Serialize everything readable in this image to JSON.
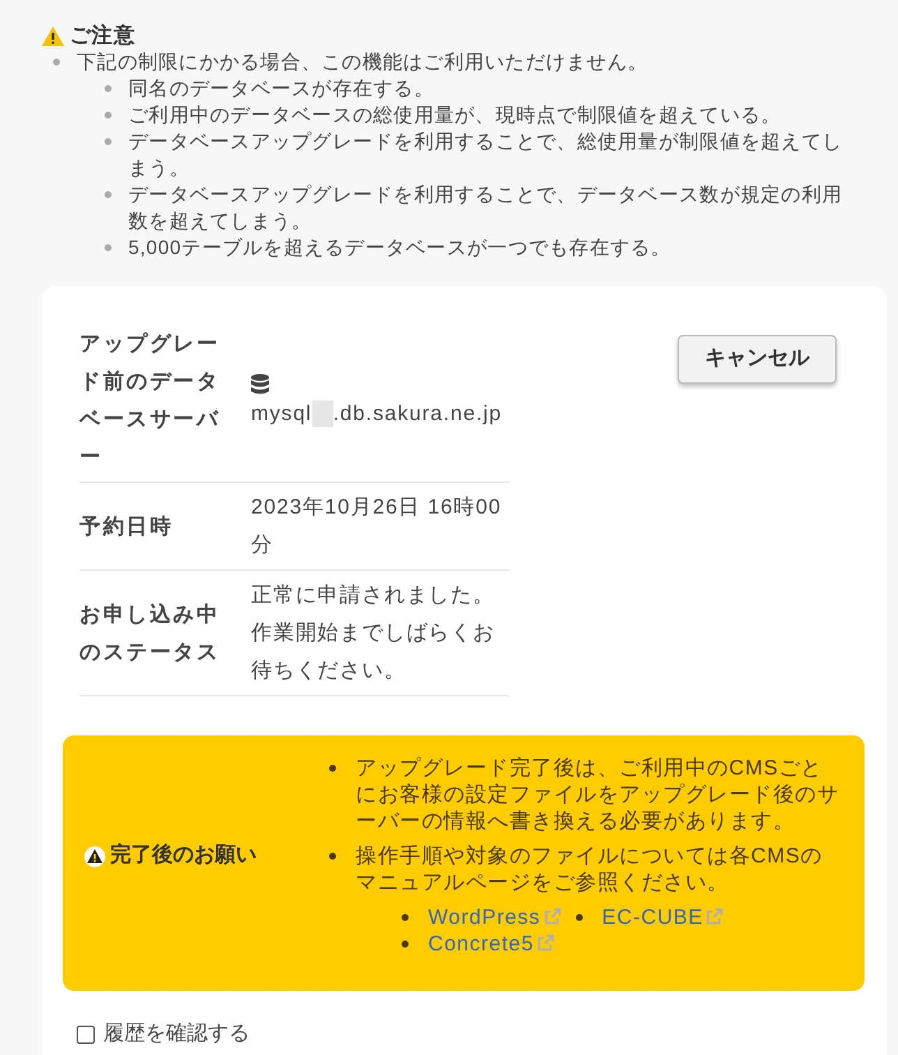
{
  "notice": {
    "title": "ご注意",
    "intro": "下記の制限にかかる場合、この機能はご利用いただけません。",
    "items": [
      "同名のデータベースが存在する。",
      "ご利用中のデータベースの総使用量が、現時点で制限値を超えている。",
      "データベースアップグレードを利用することで、総使用量が制限値を超えてしまう。",
      "データベースアップグレードを利用することで、データベース数が規定の利用数を超えてしまう。",
      "5,000テーブルを超えるデータベースが一つでも存在する。"
    ]
  },
  "details": {
    "rows": [
      {
        "kind": "server",
        "label": "アップグレード前のデータベースサーバー",
        "prefix": "mysql",
        "suffix": ".db.sakura.ne.jp",
        "redacted": true
      },
      {
        "kind": "text",
        "label": "予約日時",
        "value": "2023年10月26日 16時00分"
      },
      {
        "kind": "text",
        "label": "お申し込み中のステータス",
        "value": "正常に申請されました。作業開始までしばらくお待ちください。"
      }
    ],
    "cancel_button": "キャンセル"
  },
  "request": {
    "title": "完了後のお願い",
    "items": [
      "アップグレード完了後は、ご利用中のCMSごとにお客様の設定ファイルをアップグレード後のサーバーの情報へ書き換える必要があります。",
      "操作手順や対象のファイルについては各CMSのマニュアルページをご参照ください。"
    ],
    "links": [
      "WordPress",
      "EC-CUBE",
      "Concrete5"
    ]
  },
  "history": {
    "label": "履歴を確認する",
    "checked": false
  }
}
